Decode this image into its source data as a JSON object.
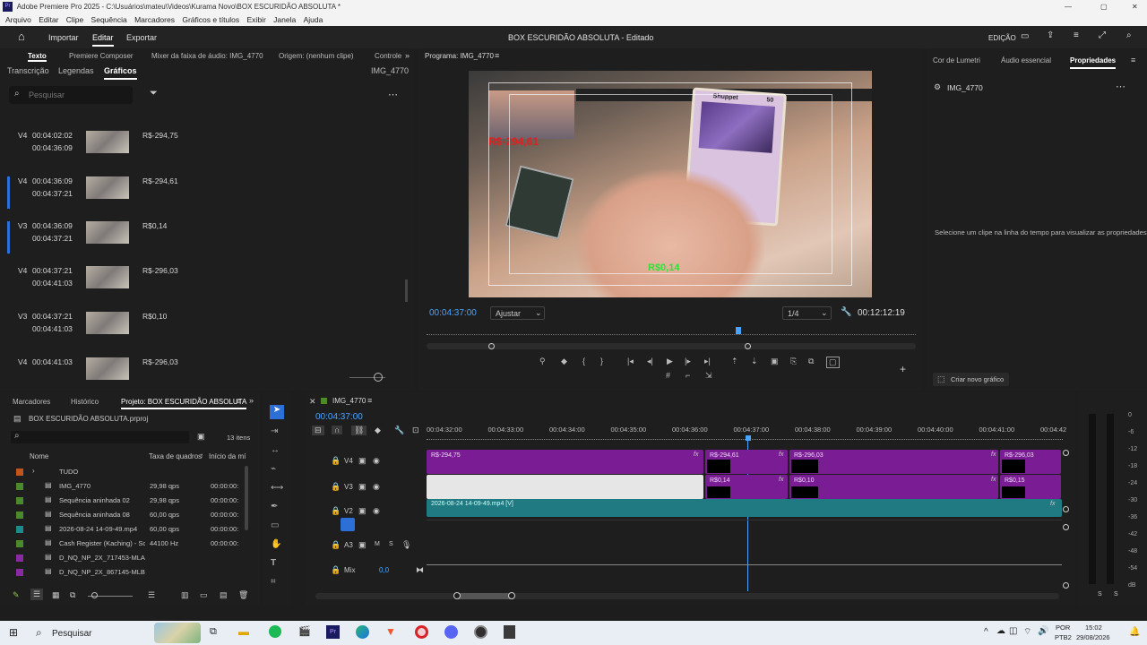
{
  "app_title": "Adobe Premiere Pro 2025 - C:\\Usuários\\mateu\\Videos\\Kurama Novo\\BOX ESCURIDÃO ABSOLUTA *",
  "menu": [
    "Arquivo",
    "Editar",
    "Clipe",
    "Sequência",
    "Marcadores",
    "Gráficos e títulos",
    "Exibir",
    "Janela",
    "Ajuda"
  ],
  "header": {
    "nav": [
      "Importar",
      "Editar",
      "Exportar"
    ],
    "project_title": "BOX ESCURIDÃO ABSOLUTA",
    "status": " - Editado",
    "workspace": "EDIÇÃO"
  },
  "left_panel": {
    "tabs": [
      "Texto",
      "Premiere Composer",
      "Mixer da faixa de áudio: IMG_4770",
      "Origem: (nenhum clipe)",
      "Controle"
    ],
    "subtabs": [
      "Transcrição",
      "Legendas",
      "Gráficos"
    ],
    "clip_name": "IMG_4770",
    "search_placeholder": "Pesquisar",
    "items": [
      {
        "track": "V4",
        "in": "00:04:02:02",
        "out": "00:04:36:09",
        "text": "R$-294,75",
        "selected": false
      },
      {
        "track": "V4",
        "in": "00:04:36:09",
        "out": "00:04:37:21",
        "text": "R$-294,61",
        "selected": true
      },
      {
        "track": "V3",
        "in": "00:04:36:09",
        "out": "00:04:37:21",
        "text": "R$0,14",
        "selected": true
      },
      {
        "track": "V4",
        "in": "00:04:37:21",
        "out": "00:04:41:03",
        "text": "R$-296,03",
        "selected": false
      },
      {
        "track": "V3",
        "in": "00:04:37:21",
        "out": "00:04:41:03",
        "text": "R$0,10",
        "selected": false
      },
      {
        "track": "V4",
        "in": "00:04:41:03",
        "out": "",
        "text": "R$-296,03",
        "selected": false
      }
    ]
  },
  "program": {
    "title": "Programa: IMG_4770",
    "timecode": "00:04:37:00",
    "fit": "Ajustar",
    "quality": "1/4",
    "duration": "00:12:12:19",
    "overlay_red": "R$-294,61",
    "overlay_green": "R$0,14",
    "card_name": "Shuppet",
    "card_hp": "50"
  },
  "right_panel": {
    "tabs": [
      "Cor de Lumetri",
      "Áudio essencial",
      "Propriedades"
    ],
    "clip": "IMG_4770",
    "message": "Selecione um clipe na linha do tempo para visualizar as propriedades.",
    "create_button": "Criar novo gráfico"
  },
  "project": {
    "tabs": [
      "Marcadores",
      "Histórico",
      "Projeto: BOX ESCURIDÃO ABSOLUTA"
    ],
    "file": "BOX ESCURIDÃO ABSOLUTA.prproj",
    "count": "13 itens",
    "cols": [
      "Nome",
      "Taxa de quadros",
      "Início da mí"
    ],
    "rows": [
      {
        "name": "TUDO",
        "rate": "",
        "start": "",
        "color": "#c2541f"
      },
      {
        "name": "IMG_4770",
        "rate": "29,98 qps",
        "start": "00:00:00:",
        "color": "#4b8a2a"
      },
      {
        "name": "Sequência aninhada 02",
        "rate": "29,98 qps",
        "start": "00:00:00:",
        "color": "#4b8a2a"
      },
      {
        "name": "Sequência aninhada 08",
        "rate": "60,00 qps",
        "start": "00:00:00:",
        "color": "#4b8a2a"
      },
      {
        "name": "2026-08-24 14-09-49.mp4",
        "rate": "60,00 qps",
        "start": "00:00:00:",
        "color": "#1f8a8a"
      },
      {
        "name": "Cash Register (Kaching) - So",
        "rate": "44100 Hz",
        "start": "00:00:00:",
        "color": "#4b8a2a"
      },
      {
        "name": "D_NQ_NP_2X_717453-MLA",
        "rate": "",
        "start": "",
        "color": "#8a2aa0"
      },
      {
        "name": "D_NQ_NP_2X_867145-MLB",
        "rate": "",
        "start": "",
        "color": "#8a2aa0"
      }
    ]
  },
  "timeline": {
    "title": "IMG_4770",
    "timecode": "00:04:37:00",
    "ruler": [
      "00:04:32:00",
      "00:04:33:00",
      "00:04:34:00",
      "00:04:35:00",
      "00:04:36:00",
      "00:04:37:00",
      "00:04:38:00",
      "00:04:39:00",
      "00:04:40:00",
      "00:04:41:00",
      "00:04:42"
    ],
    "tracks": [
      "V4",
      "V3",
      "V2",
      "A3",
      "Mix"
    ],
    "mix_value": "0,0",
    "clips": {
      "v4": [
        "R$-294,75",
        "R$-294,61",
        "R$-296,03",
        "R$-296,03"
      ],
      "v3": [
        "R$0,14",
        "R$0,10",
        "R$0,15"
      ],
      "v2": "2026-08-24 14-09-49.mp4 [V]"
    }
  },
  "meter": {
    "labels": [
      "0",
      "-6",
      "-12",
      "-18",
      "-24",
      "-30",
      "-36",
      "-42",
      "-48",
      "-54",
      "dB"
    ],
    "bottom": [
      "S",
      "S"
    ]
  },
  "taskbar": {
    "search": "Pesquisar",
    "lang": "POR",
    "kbd": "PTB2",
    "time": "15:02",
    "date": "29/08/2026"
  }
}
